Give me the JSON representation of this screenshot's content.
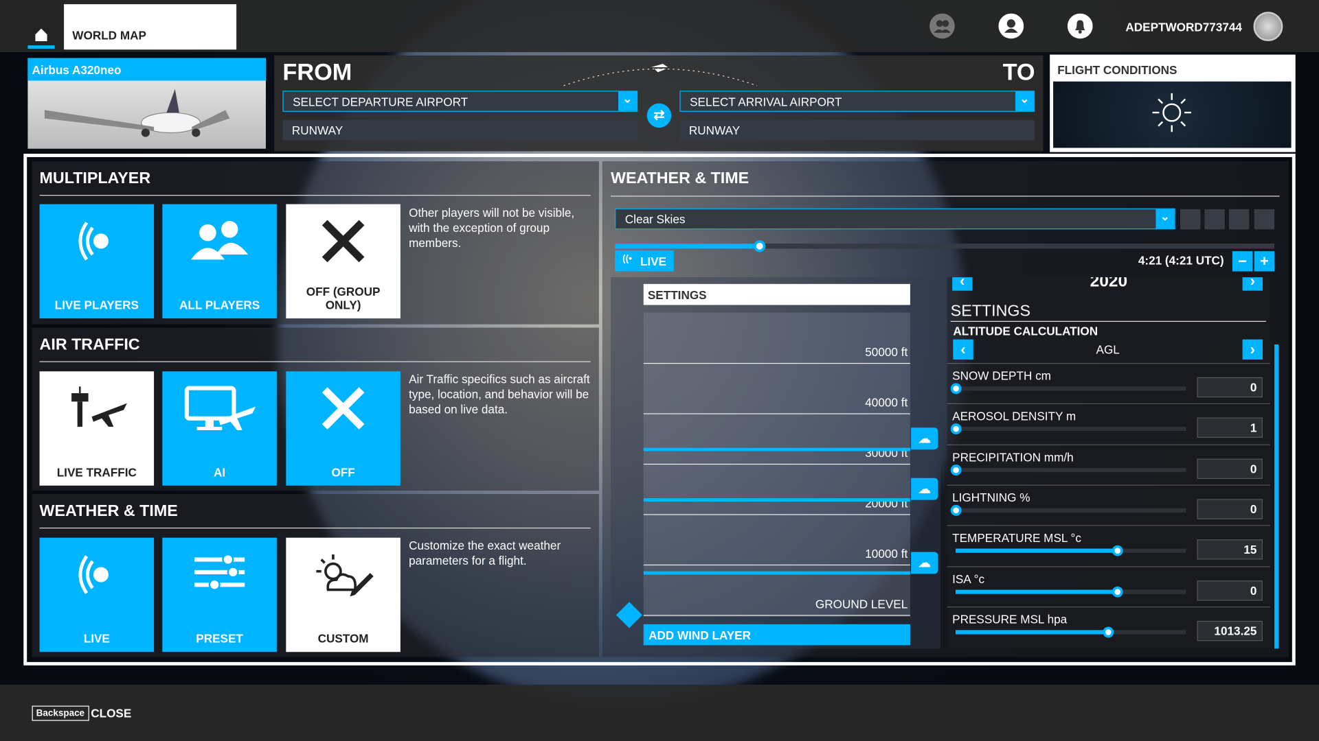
{
  "topbar": {
    "tab": "WORLD MAP",
    "username": "ADEPTWORD773744",
    "icons": [
      "home-icon",
      "friends-icon",
      "profile-icon",
      "notifications-icon",
      "avatar"
    ]
  },
  "aircraft": {
    "name": "Airbus A320neo"
  },
  "route": {
    "from_label": "FROM",
    "to_label": "TO",
    "departure_placeholder": "SELECT DEPARTURE AIRPORT",
    "arrival_placeholder": "SELECT ARRIVAL AIRPORT",
    "departure_runway": "RUNWAY",
    "arrival_runway": "RUNWAY"
  },
  "flight_conditions": {
    "title": "FLIGHT CONDITIONS",
    "icon": "sun-icon"
  },
  "multiplayer": {
    "title": "MULTIPLAYER",
    "options": [
      {
        "label": "LIVE PLAYERS",
        "selected": true
      },
      {
        "label": "ALL PLAYERS",
        "selected": true
      },
      {
        "label": "OFF (GROUP ONLY)",
        "selected": false
      }
    ],
    "description": "Other players will not be visible, with the exception of group members."
  },
  "air_traffic": {
    "title": "AIR TRAFFIC",
    "options": [
      {
        "label": "LIVE TRAFFIC",
        "selected": false
      },
      {
        "label": "AI",
        "selected": true
      },
      {
        "label": "OFF",
        "selected": true
      }
    ],
    "description": "Air Traffic specifics such as aircraft type, location, and behavior will be based on live data."
  },
  "weather_left": {
    "title": "WEATHER & TIME",
    "options": [
      {
        "label": "LIVE",
        "selected": true
      },
      {
        "label": "PRESET",
        "selected": true
      },
      {
        "label": "CUSTOM",
        "selected": false
      }
    ],
    "description": "Customize the exact weather parameters for a flight."
  },
  "weather": {
    "title": "WEATHER & TIME",
    "preset": "Clear Skies",
    "time_slider_percent": 22,
    "live_label": "LIVE",
    "time": "4:21 (4:21 UTC)",
    "year": "2020",
    "altitude_panel": {
      "header": "SETTINGS",
      "levels": [
        "50000 ft",
        "40000 ft",
        "30000 ft",
        "20000 ft",
        "10000 ft",
        "GROUND LEVEL"
      ],
      "add_wind_label": "ADD WIND LAYER"
    },
    "settings": {
      "title": "SETTINGS",
      "altitude_calc_label": "ALTITUDE CALCULATION",
      "altitude_calc_value": "AGL",
      "rows": [
        {
          "label": "SNOW DEPTH cm",
          "value": "0",
          "percent": 0
        },
        {
          "label": "AEROSOL DENSITY m",
          "value": "1",
          "percent": 0
        },
        {
          "label": "PRECIPITATION mm/h",
          "value": "0",
          "percent": 0
        },
        {
          "label": "LIGHTNING %",
          "value": "0",
          "percent": 0
        },
        {
          "label": "TEMPERATURE MSL °c",
          "value": "15",
          "percent": 70
        },
        {
          "label": "ISA °c",
          "value": "0",
          "percent": 70
        },
        {
          "label": "PRESSURE MSL hpa",
          "value": "1013.25",
          "percent": 66
        }
      ]
    }
  },
  "footer": {
    "key": "Backspace",
    "close": "CLOSE"
  },
  "colors": {
    "accent": "#00b4ff",
    "panel": "#333a44"
  }
}
